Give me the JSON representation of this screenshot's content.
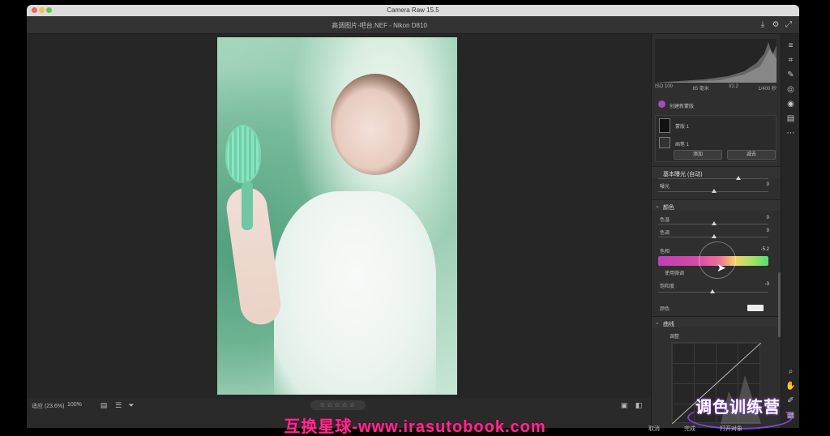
{
  "window": {
    "title": "Camera Raw 15.5",
    "doc_name": "高调图片-吧台.NEF - Nikon D810"
  },
  "histogram_info": {
    "iso": "ISO 100",
    "focal": "85 毫米",
    "aperture": "f/2.2",
    "shutter": "1/400 秒"
  },
  "mask_panel": {
    "title": "创建新蒙版",
    "layer_label": "蒙版 1",
    "item_label": "画笔 1",
    "add_button": "添加",
    "subtract_button": "减去"
  },
  "adjust_section": {
    "header": "基本曝光 (自动)",
    "row1_label": "曝光",
    "row1_value": "0"
  },
  "color_section": {
    "header": "颜色",
    "temp_label": "色温",
    "temp_value": "0",
    "tint_label": "色调",
    "tint_value": "0",
    "hue_label": "色相",
    "hue_value": "-5.2",
    "hue_checkbox": "使用微调",
    "sat_label": "饱和度",
    "sat_value": "-3",
    "color_label": "颜色"
  },
  "curve_section": {
    "header": "曲线",
    "sub_label": "调整"
  },
  "bottom": {
    "zoom_fit": "适应 (23.6%)",
    "zoom_percent": "100%",
    "rating": "☆☆☆☆☆"
  },
  "overlay": {
    "watermark": "互换星球-www.irasutobook.com",
    "brand": "调色训练营",
    "cancel": "取消",
    "done": "完成",
    "open": "打开对象"
  },
  "toolstrip_icons": [
    "edit-icon",
    "crop-icon",
    "heal-icon",
    "mask-icon",
    "redeye-icon",
    "presets-icon",
    "more-icon",
    "zoom-icon",
    "hand-icon",
    "sampler-icon",
    "grid-icon"
  ]
}
